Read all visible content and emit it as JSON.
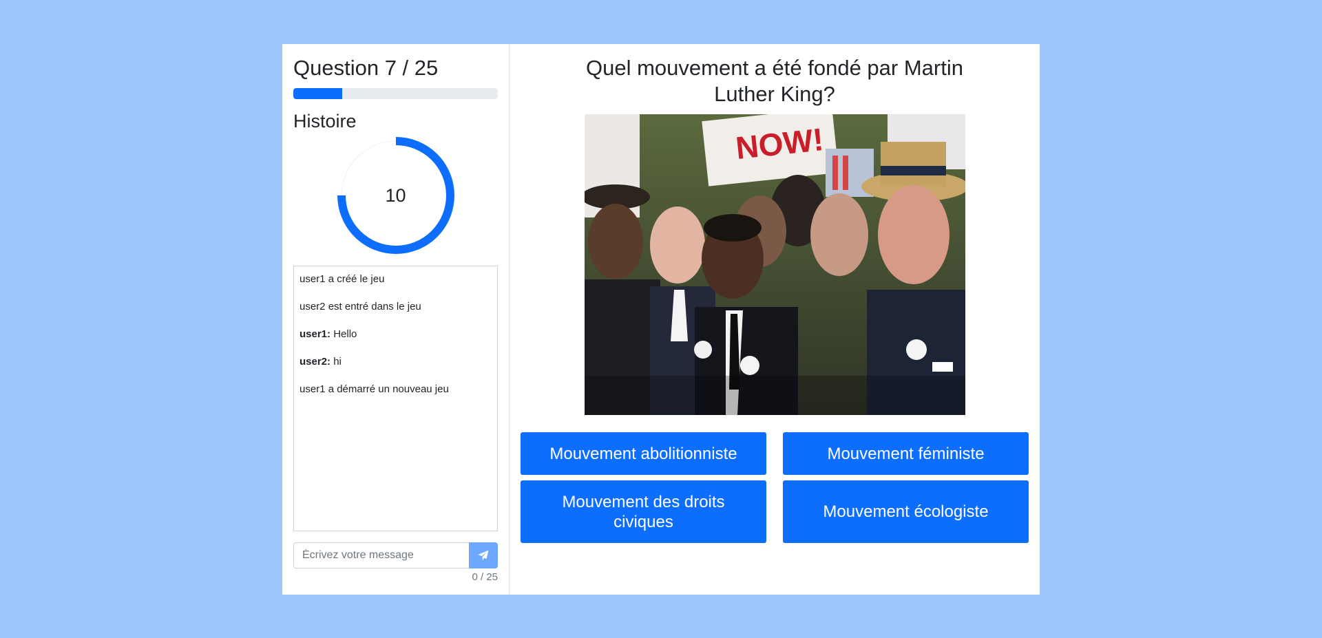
{
  "question_header": "Question 7 / 25",
  "progress": 0.24,
  "category": "Histoire",
  "timer": {
    "value": "10",
    "remaining_fraction": 0.75
  },
  "chat": {
    "messages": [
      {
        "text": "user1 a créé le jeu"
      },
      {
        "text": "user2 est entré dans le jeu"
      },
      {
        "user": "user1:",
        "text": "Hello"
      },
      {
        "user": "user2:",
        "text": "hi"
      },
      {
        "text": "user1 a démarré un nouveau jeu"
      }
    ],
    "placeholder": "Écrivez votre message",
    "count": "0 / 25"
  },
  "question": "Quel mouvement a été fondé par Martin Luther King?",
  "image": {
    "sign_text": "NOW!"
  },
  "answers": [
    "Mouvement abolitionniste",
    "Mouvement féministe",
    "Mouvement des droits civiques",
    "Mouvement écologiste"
  ],
  "colors": {
    "background": "#9fc5fd",
    "accent": "#0d6efd",
    "send_button": "#6ea8fe"
  }
}
